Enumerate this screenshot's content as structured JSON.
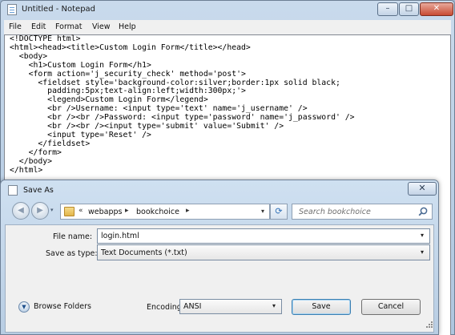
{
  "notepad": {
    "title": "Untitled - Notepad",
    "controls": {
      "minimize": "–",
      "maximize": "□",
      "close": "✕"
    },
    "menu": [
      "File",
      "Edit",
      "Format",
      "View",
      "Help"
    ],
    "code_lines": [
      "<!DOCTYPE html>",
      "<html><head><title>Custom Login Form</title></head>",
      "  <body>",
      "    <h1>Custom Login Form</h1>",
      "    <form action='j_security_check' method='post'>",
      "      <fieldset style='background-color:silver;border:1px solid black;",
      "        padding:5px;text-align:left;width:300px;'>",
      "        <legend>Custom Login Form</legend>",
      "        <br />Username: <input type='text' name='j_username' />",
      "        <br /><br />Password: <input type='password' name='j_password' />",
      "        <br /><br /><input type='submit' value='Submit' />",
      "        <input type='Reset' />",
      "      </fieldset>",
      "    </form>",
      "  </body>",
      "</html>"
    ]
  },
  "save_as": {
    "title": "Save As",
    "close": "✕",
    "nav": {
      "back": "◀",
      "forward": "▶",
      "dropdown": "▾"
    },
    "address": {
      "prefix": "«",
      "crumbs": [
        "webapps",
        "bookchoice"
      ],
      "sep": "▸",
      "dropdown": "▾"
    },
    "refresh": "⟳",
    "search_placeholder": "Search bookchoice",
    "file_name": {
      "label": "File name:",
      "value": "login.html",
      "dropdown": "▾"
    },
    "save_as_type": {
      "label": "Save as type:",
      "value": "Text Documents (*.txt)",
      "dropdown": "▾"
    },
    "browse_folders": {
      "label": "Browse Folders",
      "icon": "▼"
    },
    "encoding": {
      "label": "Encoding:",
      "value": "ANSI",
      "dropdown": "▾"
    },
    "buttons": {
      "save": "Save",
      "cancel": "Cancel"
    }
  }
}
